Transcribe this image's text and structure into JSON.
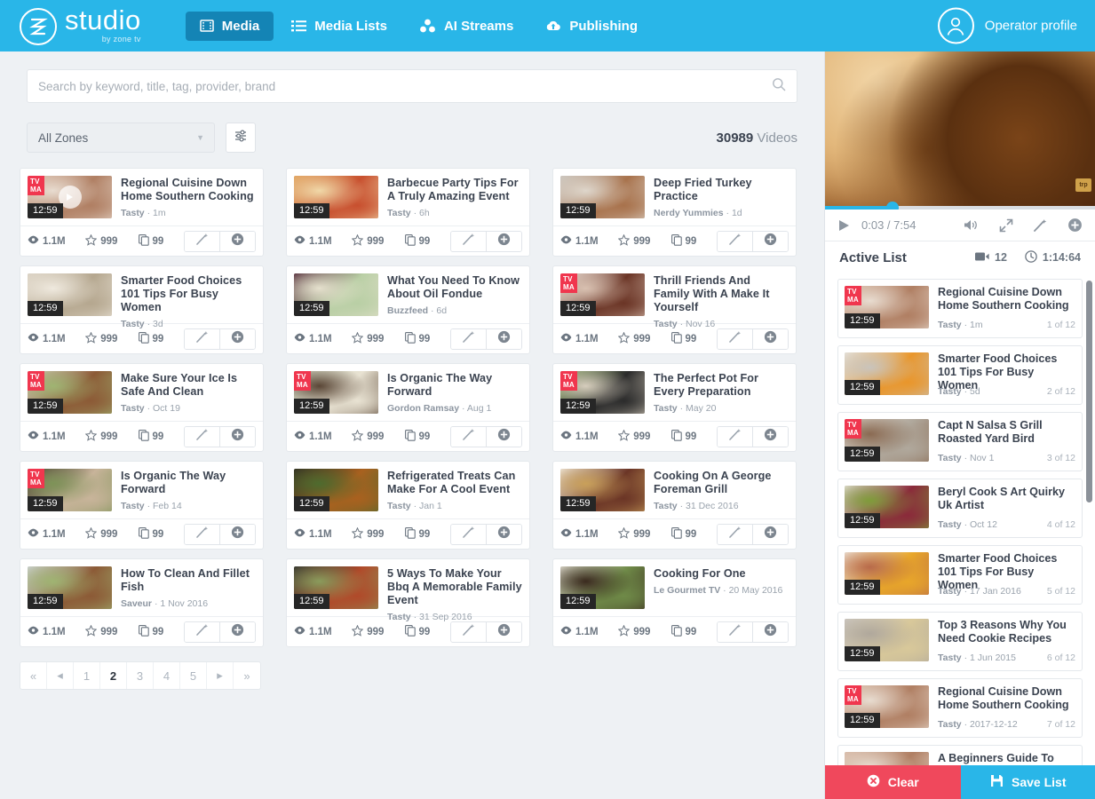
{
  "header": {
    "logo_word": "studio",
    "logo_sub": "by zone tv",
    "logo_icon": "zone-logo-icon",
    "nav": [
      {
        "label": "Media",
        "icon": "film-icon",
        "active": true
      },
      {
        "label": "Media Lists",
        "icon": "list-icon",
        "active": false
      },
      {
        "label": "AI Streams",
        "icon": "nodes-icon",
        "active": false
      },
      {
        "label": "Publishing",
        "icon": "cloud-upload-icon",
        "active": false
      }
    ],
    "profile_label": "Operator profile",
    "profile_icon": "user-circle-icon",
    "bg_color": "#29b6e8",
    "active_nav_color": "#1484b5"
  },
  "search": {
    "placeholder": "Search by keyword, title, tag, provider, brand",
    "value": "",
    "icon": "search-icon"
  },
  "filters": {
    "zone_selected": "All Zones",
    "zone_caret_icon": "chevron-down-icon",
    "settings_icon": "sliders-icon",
    "count_number": "30989",
    "count_label": "Videos"
  },
  "card_stats": {
    "views": "1.1M",
    "stars": "999",
    "copies": "99",
    "views_icon": "eye-icon",
    "stars_icon": "star-icon",
    "copies_icon": "copy-icon",
    "magic_icon": "magic-wand-icon",
    "add_icon": "plus-circle-icon"
  },
  "cards": [
    {
      "title": "Regional Cuisine Down Home Southern Cooking",
      "provider": "Tasty",
      "date": "1m",
      "duration": "12:59",
      "rating": "TV MA",
      "has_play_overlay": true,
      "thumb_colors": [
        "#d7b9a6",
        "#b07f63",
        "#e8dcd0"
      ]
    },
    {
      "title": "Barbecue Party Tips For A Truly Amazing Event",
      "provider": "Tasty",
      "date": "6h",
      "duration": "12:59",
      "rating": "",
      "has_play_overlay": false,
      "thumb_colors": [
        "#e0a05a",
        "#c8502f",
        "#f0d8a8"
      ]
    },
    {
      "title": "Deep Fried Turkey Practice",
      "provider": "Nerdy Yummies",
      "date": "1d",
      "duration": "12:59",
      "rating": "",
      "has_play_overlay": false,
      "thumb_colors": [
        "#c9c4bd",
        "#a8724c",
        "#ded6cb"
      ]
    },
    {
      "title": "Smarter Food Choices 101 Tips For Busy Women",
      "provider": "Tasty",
      "date": "3d",
      "duration": "12:59",
      "rating": "",
      "has_play_overlay": false,
      "thumb_colors": [
        "#d8cfc0",
        "#b5a78f",
        "#efe9de"
      ]
    },
    {
      "title": "What You Need To Know About Oil Fondue",
      "provider": "Buzzfeed",
      "date": "6d",
      "duration": "12:59",
      "rating": "",
      "has_play_overlay": false,
      "thumb_colors": [
        "#4a2030",
        "#b9cfa5",
        "#e5e0cd"
      ]
    },
    {
      "title": "Thrill Friends And Family With A Make It Yourself",
      "provider": "Tasty",
      "date": "Nov 16",
      "duration": "12:59",
      "rating": "TV MA",
      "has_play_overlay": false,
      "thumb_colors": [
        "#efe6de",
        "#6b3526",
        "#d8c0b0"
      ]
    },
    {
      "title": "Make Sure Your Ice Is Safe And Clean",
      "provider": "Tasty",
      "date": "Oct 19",
      "duration": "12:59",
      "rating": "TV MA",
      "has_play_overlay": false,
      "thumb_colors": [
        "#d9cfc4",
        "#8c5a36",
        "#9fb472"
      ]
    },
    {
      "title": "Is Organic The Way Forward",
      "provider": "Gordon Ramsay",
      "date": "Aug 1",
      "duration": "12:59",
      "rating": "TV MA",
      "has_play_overlay": false,
      "thumb_colors": [
        "#cfd6c0",
        "#e8e2d2",
        "#5a4636"
      ]
    },
    {
      "title": "The Perfect Pot For Every Preparation",
      "provider": "Tasty",
      "date": "May 20",
      "duration": "12:59",
      "rating": "TV MA",
      "has_play_overlay": false,
      "thumb_colors": [
        "#8fae6a",
        "#2b2b2b",
        "#d6cdbd"
      ]
    },
    {
      "title": "Is Organic The Way Forward",
      "provider": "Tasty",
      "date": "Feb 14",
      "duration": "12:59",
      "rating": "TV MA",
      "has_play_overlay": false,
      "thumb_colors": [
        "#3a2a22",
        "#c8b49a",
        "#7e9358"
      ]
    },
    {
      "title": "Refrigerated Treats Can Make For A Cool Event",
      "provider": "Tasty",
      "date": "Jan 1",
      "duration": "12:59",
      "rating": "",
      "has_play_overlay": false,
      "thumb_colors": [
        "#2e2a22",
        "#a9611f",
        "#4e6b2e"
      ]
    },
    {
      "title": "Cooking On A George Foreman Grill",
      "provider": "Tasty",
      "date": "31 Dec 2016",
      "duration": "12:59",
      "rating": "",
      "has_play_overlay": false,
      "thumb_colors": [
        "#efe8df",
        "#6b3526",
        "#c9a05a"
      ]
    },
    {
      "title": "How To Clean And Fillet Fish",
      "provider": "Saveur",
      "date": "1 Nov 2016",
      "duration": "12:59",
      "rating": "",
      "has_play_overlay": false,
      "thumb_colors": [
        "#cfd4d8",
        "#8c5a36",
        "#9fb472"
      ]
    },
    {
      "title": "5 Ways To Make Your Bbq A Memorable Family Event",
      "provider": "Tasty",
      "date": "31 Sep 2016",
      "duration": "12:59",
      "rating": "",
      "has_play_overlay": false,
      "thumb_colors": [
        "#2b2b2b",
        "#b04a2a",
        "#8a9b5c"
      ]
    },
    {
      "title": "Cooking For One",
      "provider": "Le Gourmet TV",
      "date": "20 May 2016",
      "duration": "12:59",
      "rating": "",
      "has_play_overlay": false,
      "thumb_colors": [
        "#e8e4d8",
        "#6f8a48",
        "#3a2a1e"
      ]
    }
  ],
  "pagination": {
    "first_icon": "double-chevron-left-icon",
    "prev_icon": "chevron-left-icon",
    "pages": [
      "1",
      "2",
      "3",
      "4",
      "5"
    ],
    "current": "2",
    "next_icon": "chevron-right-icon",
    "last_icon": "double-chevron-right-icon"
  },
  "player": {
    "current_time": "0:03",
    "separator": "/",
    "total_time": "7:54",
    "time_display": "0:03 / 7:54",
    "progress_percent": 25,
    "play_icon": "play-icon",
    "volume_icon": "volume-icon",
    "fullscreen_icon": "expand-icon",
    "magic_icon": "magic-wand-icon",
    "add_icon": "plus-circle-icon",
    "watermark": "logo",
    "accent_color": "#29b6e8"
  },
  "active_list": {
    "title": "Active List",
    "video_count": "12",
    "video_icon": "video-camera-icon",
    "duration": "1:14:64",
    "clock_icon": "clock-icon",
    "items": [
      {
        "title": "Regional Cuisine Down Home Southern Cooking",
        "provider": "Tasty",
        "date": "1m",
        "duration": "12:59",
        "rating": "TV MA",
        "index": "1 of 12",
        "thumb_colors": [
          "#d7b9a6",
          "#b07f63",
          "#e8dcd0"
        ]
      },
      {
        "title": "Smarter Food Choices 101 Tips For Busy Women",
        "provider": "Tasty",
        "date": "5d",
        "duration": "12:59",
        "rating": "",
        "index": "2 of 12",
        "thumb_colors": [
          "#e8e4dc",
          "#e9962b",
          "#c9c4bc"
        ]
      },
      {
        "title": "Capt N Salsa S Grill Roasted Yard Bird",
        "provider": "Tasty",
        "date": "Nov 1",
        "duration": "12:59",
        "rating": "TV MA",
        "index": "3 of 12",
        "thumb_colors": [
          "#ded6cc",
          "#b0a89c",
          "#8a6a52"
        ]
      },
      {
        "title": "Beryl Cook S Art Quirky Uk Artist",
        "provider": "Tasty",
        "date": "Oct 12",
        "duration": "12:59",
        "rating": "",
        "index": "4 of 12",
        "thumb_colors": [
          "#e6e2da",
          "#8a2a3a",
          "#7f9c3a"
        ]
      },
      {
        "title": "Smarter Food Choices 101 Tips For Busy Women",
        "provider": "Tasty",
        "date": "17 Jan 2016",
        "duration": "12:59",
        "rating": "",
        "index": "5 of 12",
        "thumb_colors": [
          "#efe8de",
          "#e8a62a",
          "#b86a4a"
        ]
      },
      {
        "title": "Top 3 Reasons Why You Need Cookie Recipes",
        "provider": "Tasty",
        "date": "1 Jun 2015",
        "duration": "12:59",
        "rating": "",
        "index": "6 of 12",
        "thumb_colors": [
          "#cdc8c2",
          "#d8c89a",
          "#b0a89c"
        ]
      },
      {
        "title": "Regional Cuisine Down Home Southern Cooking",
        "provider": "Tasty",
        "date": "2017-12-12",
        "duration": "12:59",
        "rating": "TV MA",
        "index": "7 of 12",
        "thumb_colors": [
          "#d7b9a6",
          "#b07f63",
          "#e8dcd0"
        ]
      },
      {
        "title": "A Beginners Guide To",
        "provider": "",
        "date": "",
        "duration": "",
        "rating": "",
        "index": "",
        "thumb_colors": [
          "#d7b9a6",
          "#b07f63",
          "#e8dcd0"
        ]
      }
    ]
  },
  "footer": {
    "clear_label": "Clear",
    "clear_icon": "close-circle-icon",
    "clear_color": "#f0485c",
    "save_label": "Save List",
    "save_icon": "save-disk-icon",
    "save_color": "#29b6e8"
  }
}
